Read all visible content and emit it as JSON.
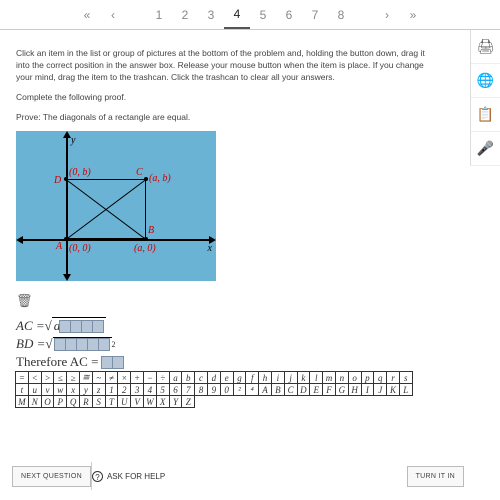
{
  "nav": {
    "first": "«",
    "prev": "‹",
    "next": "›",
    "last": "»",
    "pages": [
      "1",
      "2",
      "3",
      "4",
      "5",
      "6",
      "7",
      "8"
    ],
    "active": 4
  },
  "sidebar": {
    "print": "🖨",
    "globe": "🌐",
    "copy": "📋",
    "mic": "🎤"
  },
  "instructions": "Click an item in the list or group of pictures at the bottom of the problem and, holding the button down, drag it into the correct position in the answer box. Release your mouse button when the item is place. If you change your mind, drag the item to the trashcan. Click the trashcan to clear all your answers.",
  "task1": "Complete the following proof.",
  "task2": "Prove: The diagonals of a rectangle are equal.",
  "figure": {
    "D": "D",
    "C": "C",
    "A": "A",
    "B": "B",
    "coordC": "(a, b)",
    "coordD": "(0, b)",
    "coordA": "(0, 0)",
    "coordB": "(a, 0)",
    "x": "x",
    "y": "y"
  },
  "trash": "🗑",
  "eq": {
    "line1a": "AC = ",
    "rad": "√",
    "a": "a",
    "line2a": "BD = ",
    "exp2": "2",
    "line3a": "Therefore AC ="
  },
  "tiles": {
    "row1": [
      "=",
      "<",
      ">",
      "≤",
      "≥",
      "≅",
      "~",
      "≠",
      "×",
      "+",
      "−",
      "÷",
      "a",
      "b",
      "c",
      "d",
      "e",
      "g",
      "f",
      "h",
      "i",
      "j",
      "k",
      "l",
      "m",
      "n",
      "o",
      "p",
      "q",
      "r",
      "s"
    ],
    "row2": [
      "t",
      "u",
      "v",
      "w",
      "x",
      "y",
      "z",
      "1",
      "2",
      "3",
      "4",
      "5",
      "6",
      "7",
      "8",
      "9",
      "0",
      "²",
      "⁴",
      "A",
      "B",
      "C",
      "D",
      "E",
      "F",
      "G",
      "H",
      "I",
      "J",
      "K",
      "L"
    ],
    "row3": [
      "M",
      "N",
      "O",
      "P",
      "Q",
      "R",
      "S",
      "T",
      "U",
      "V",
      "W",
      "X",
      "Y",
      "Z"
    ]
  },
  "footer": {
    "next": "NEXT QUESTION",
    "ask": "ASK FOR HELP",
    "turnin": "TURN IT IN",
    "q": "?"
  }
}
